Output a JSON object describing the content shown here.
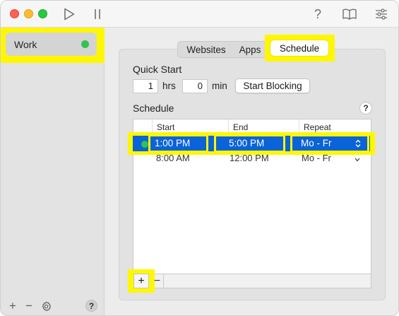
{
  "toolbar": {
    "play_icon": "play-icon",
    "pause_icon": "pause-icon",
    "help_label": "?",
    "book_icon": "book-icon",
    "settings_icon": "sliders-icon"
  },
  "sidebar": {
    "items": [
      {
        "label": "Work",
        "status_color": "#32c24d"
      }
    ],
    "footer": {
      "add_label": "+",
      "remove_label": "−",
      "help_label": "?"
    }
  },
  "tabs": {
    "items": [
      "Websites",
      "Apps",
      "Schedule"
    ],
    "selected": "Schedule"
  },
  "quick_start": {
    "title": "Quick Start",
    "hours_value": "1",
    "hours_unit": "hrs",
    "minutes_value": "0",
    "minutes_unit": "min",
    "start_button": "Start Blocking"
  },
  "schedule": {
    "title": "Schedule",
    "help_label": "?",
    "columns": [
      "Start",
      "End",
      "Repeat"
    ],
    "rows": [
      {
        "start": "1:00 PM",
        "end": "5:00 PM",
        "repeat": "Mo - Fr",
        "active": true
      },
      {
        "start": "8:00 AM",
        "end": "12:00 PM",
        "repeat": "Mo - Fr",
        "active": false
      }
    ],
    "add_label": "+",
    "remove_label": "−"
  },
  "colors": {
    "selection": "#0a63d8",
    "highlight": "#fff700",
    "status_green": "#32c24d"
  }
}
